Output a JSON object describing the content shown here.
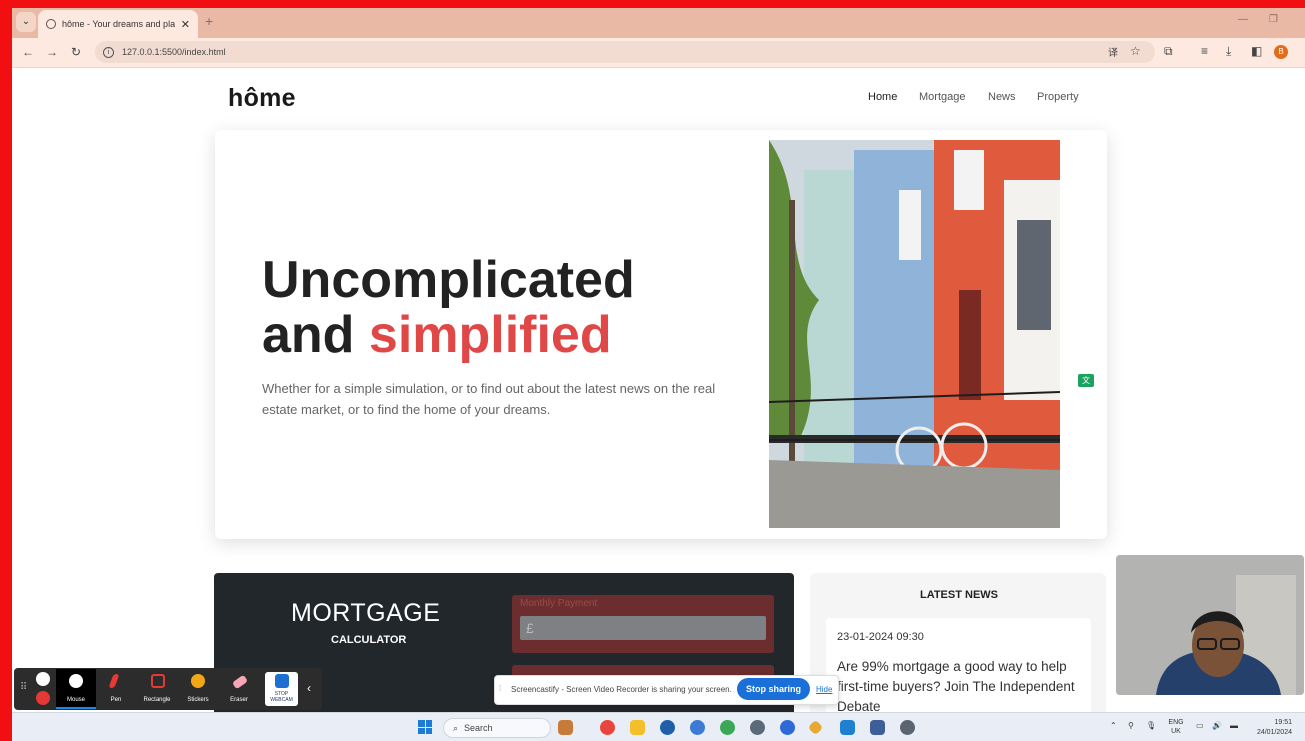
{
  "browser": {
    "tab_title": "hôme - Your dreams and plans",
    "url": "127.0.0.1:5500/index.html"
  },
  "site": {
    "logo": "hôme",
    "nav": [
      "Home",
      "Mortgage",
      "News",
      "Property"
    ],
    "active_nav": "Home",
    "hero": {
      "headline_line1": "Uncomplicated",
      "headline_and": "and ",
      "headline_highlight": "simplified",
      "lead": "Whether for a simple simulation, or to find out about the latest news on the real estate market, or to find the home of your dreams."
    },
    "mortgage": {
      "title": "MORTGAGE",
      "subtitle": "CALCULATOR",
      "field_label": "Monthly Payment",
      "field_value": "£"
    },
    "news": {
      "heading": "LATEST NEWS",
      "date": "23-01-2024 09:30",
      "title": "Are 99% mortgage a good way to help first-time buyers? Join The Independent Debate"
    }
  },
  "screencastify": {
    "tools": [
      "Mouse",
      "Pen",
      "Rectangle",
      "Stickers",
      "Eraser",
      "STOP WEBCAM"
    ],
    "sharing_text": "Screencastify - Screen Video Recorder is sharing your screen.",
    "stop_label": "Stop sharing",
    "hide_label": "Hide"
  },
  "taskbar": {
    "search_placeholder": "Search",
    "lang": "ENG",
    "region": "UK",
    "time": "19:51",
    "date": "24/01/2024"
  },
  "colors": {
    "accent_red": "#e04848",
    "frame_red": "#f20f12",
    "dark_panel": "#22272b",
    "share_blue": "#1a6fd8"
  }
}
